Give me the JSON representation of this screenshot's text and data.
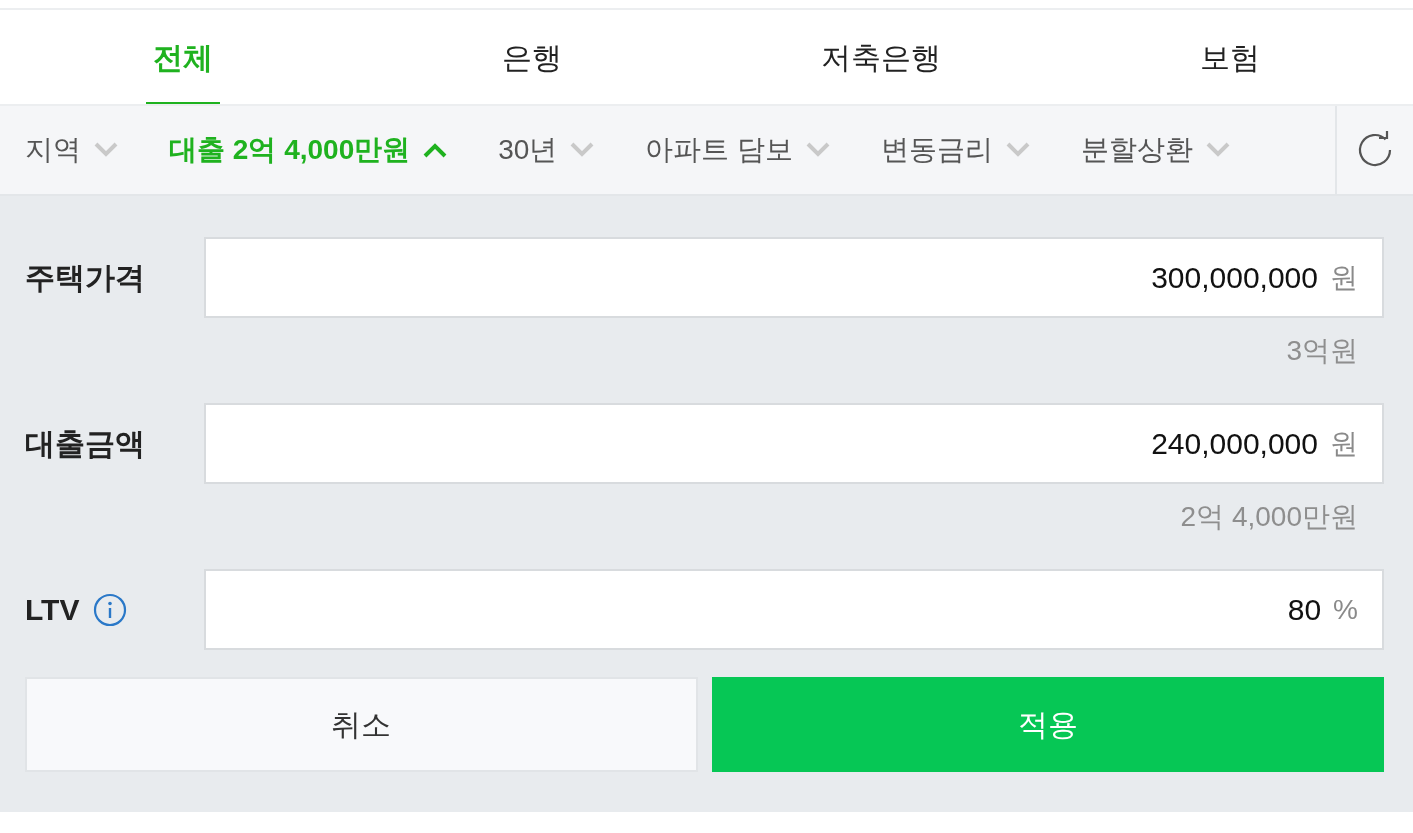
{
  "tabs": [
    {
      "label": "전체",
      "selected": true
    },
    {
      "label": "은행",
      "selected": false
    },
    {
      "label": "저축은행",
      "selected": false
    },
    {
      "label": "보험",
      "selected": false
    }
  ],
  "filters": [
    {
      "label": "지역",
      "expanded": false
    },
    {
      "label": "대출 2억 4,000만원",
      "expanded": true
    },
    {
      "label": "30년",
      "expanded": false
    },
    {
      "label": "아파트 담보",
      "expanded": false
    },
    {
      "label": "변동금리",
      "expanded": false
    },
    {
      "label": "분할상환",
      "expanded": false
    }
  ],
  "fields": [
    {
      "label": "주택가격",
      "info": false,
      "value": "300,000,000",
      "unit": "원",
      "hint": "3억원"
    },
    {
      "label": "대출금액",
      "info": false,
      "value": "240,000,000",
      "unit": "원",
      "hint": "2억 4,000만원"
    },
    {
      "label": "LTV",
      "info": true,
      "value": "80",
      "unit": "%"
    }
  ],
  "buttons": [
    {
      "label": "취소",
      "kind": "secondary"
    },
    {
      "label": "적용",
      "kind": "primary"
    }
  ]
}
